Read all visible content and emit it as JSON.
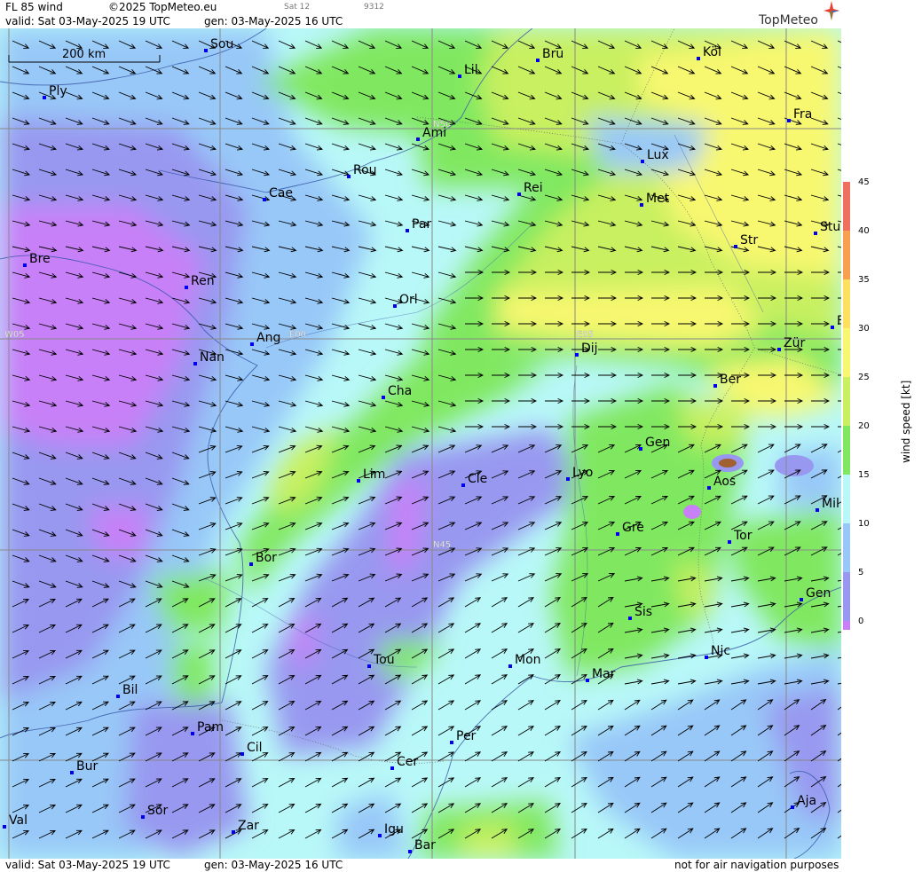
{
  "header": {
    "product": "FL 85 wind",
    "copyright": "©2025 TopMeteo.eu",
    "sat": "Sat 12",
    "code": "9312",
    "valid": "valid:  Sat  03-May-2025  19 UTC",
    "gen": "gen: 03-May-2025 16 UTC",
    "brand": "TopMeteo"
  },
  "scale": {
    "label": "200 km"
  },
  "grid_labels": [
    "N50",
    "N45",
    "W05",
    "E00",
    "E05"
  ],
  "cities": [
    {
      "name": "Sou"
    },
    {
      "name": "Ply"
    },
    {
      "name": "Lil"
    },
    {
      "name": "Bru"
    },
    {
      "name": "Köl"
    },
    {
      "name": "Ami"
    },
    {
      "name": "Fra"
    },
    {
      "name": "Rou"
    },
    {
      "name": "Lux"
    },
    {
      "name": "Cae"
    },
    {
      "name": "Rei"
    },
    {
      "name": "Met"
    },
    {
      "name": "Par"
    },
    {
      "name": "Stu"
    },
    {
      "name": "Str"
    },
    {
      "name": "Bre"
    },
    {
      "name": "Ren"
    },
    {
      "name": "Orl"
    },
    {
      "name": "Ang"
    },
    {
      "name": "Dij"
    },
    {
      "name": "Zür"
    },
    {
      "name": "Nan"
    },
    {
      "name": "Ber"
    },
    {
      "name": "Cha"
    },
    {
      "name": "Gen"
    },
    {
      "name": "Lim"
    },
    {
      "name": "Cle"
    },
    {
      "name": "Lyo"
    },
    {
      "name": "Aos"
    },
    {
      "name": "Mil"
    },
    {
      "name": "Gre"
    },
    {
      "name": "Tor"
    },
    {
      "name": "Bor"
    },
    {
      "name": "Gen"
    },
    {
      "name": "Sis"
    },
    {
      "name": "Nic"
    },
    {
      "name": "Tou"
    },
    {
      "name": "Mon"
    },
    {
      "name": "Mar"
    },
    {
      "name": "Bil"
    },
    {
      "name": "Pam"
    },
    {
      "name": "Per"
    },
    {
      "name": "Cil"
    },
    {
      "name": "Bur"
    },
    {
      "name": "Cer"
    },
    {
      "name": "Sor"
    },
    {
      "name": "Aja"
    },
    {
      "name": "Val"
    },
    {
      "name": "Zar"
    },
    {
      "name": "Igu"
    },
    {
      "name": "Bar"
    },
    {
      "name": "F"
    }
  ],
  "colorbar": {
    "ticks": [
      "45",
      "40",
      "35",
      "30",
      "25",
      "20",
      "15",
      "10",
      "5",
      "0"
    ],
    "label": "wind speed [kt]",
    "colors": [
      "#f07060",
      "#f8a050",
      "#fde060",
      "#f8f870",
      "#c8f060",
      "#80e860",
      "#b8f8f8",
      "#98c8f8",
      "#9898f0",
      "#c880f8"
    ]
  },
  "footer": {
    "valid": "valid:  Sat  03-May-2025  19 UTC",
    "gen": "gen: 03-May-2025 16 UTC",
    "disclaimer": "not for air navigation purposes"
  }
}
